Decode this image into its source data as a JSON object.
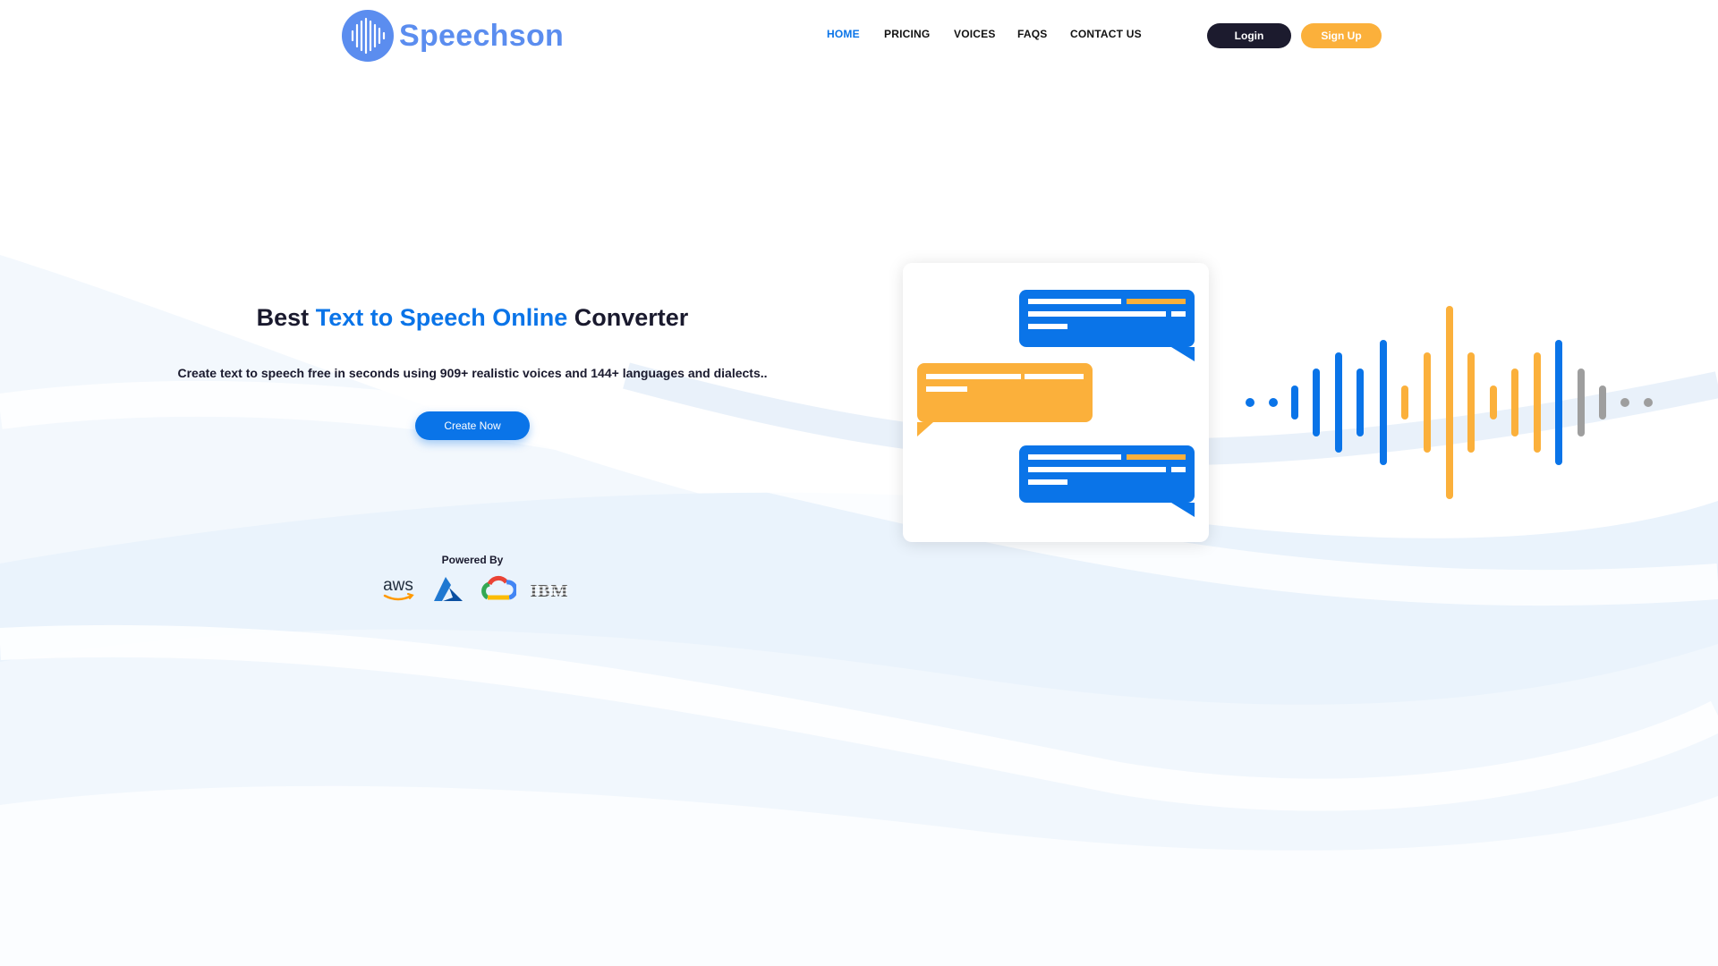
{
  "brand": {
    "name": "Speechson",
    "logo_icon": "soundwave-circle-icon",
    "color": "#5b8def"
  },
  "nav": {
    "items": [
      {
        "label": "HOME",
        "active": true
      },
      {
        "label": "PRICING",
        "active": false
      },
      {
        "label": "VOICES",
        "active": false
      },
      {
        "label": "FAQS",
        "active": false
      },
      {
        "label": "CONTACT US",
        "active": false
      }
    ],
    "active_color": "#0a74e8"
  },
  "auth": {
    "login_label": "Login",
    "signup_label": "Sign Up",
    "login_color": "#1c1b2e",
    "signup_color": "#fbb03b"
  },
  "hero": {
    "title_prefix": "Best",
    "title_accent": "Text to Speech Online",
    "title_suffix": "Converter",
    "subtitle": "Create text to speech free in seconds using 909+ realistic voices and 144+ languages and dialects..",
    "cta_label": "Create Now",
    "accent_color": "#0a74e8"
  },
  "powered_by": {
    "label": "Powered By",
    "logos": [
      "aws-logo",
      "azure-logo",
      "google-cloud-logo",
      "ibm-logo"
    ]
  },
  "illustration": {
    "chat_icons": [
      "chat-bubble-blue-icon",
      "chat-bubble-orange-icon",
      "chat-bubble-blue-icon"
    ],
    "wave_icon": "sound-wave-icon",
    "colors": {
      "blue": "#0a74e8",
      "orange": "#fbb03b",
      "gray": "#9e9e9e"
    }
  }
}
